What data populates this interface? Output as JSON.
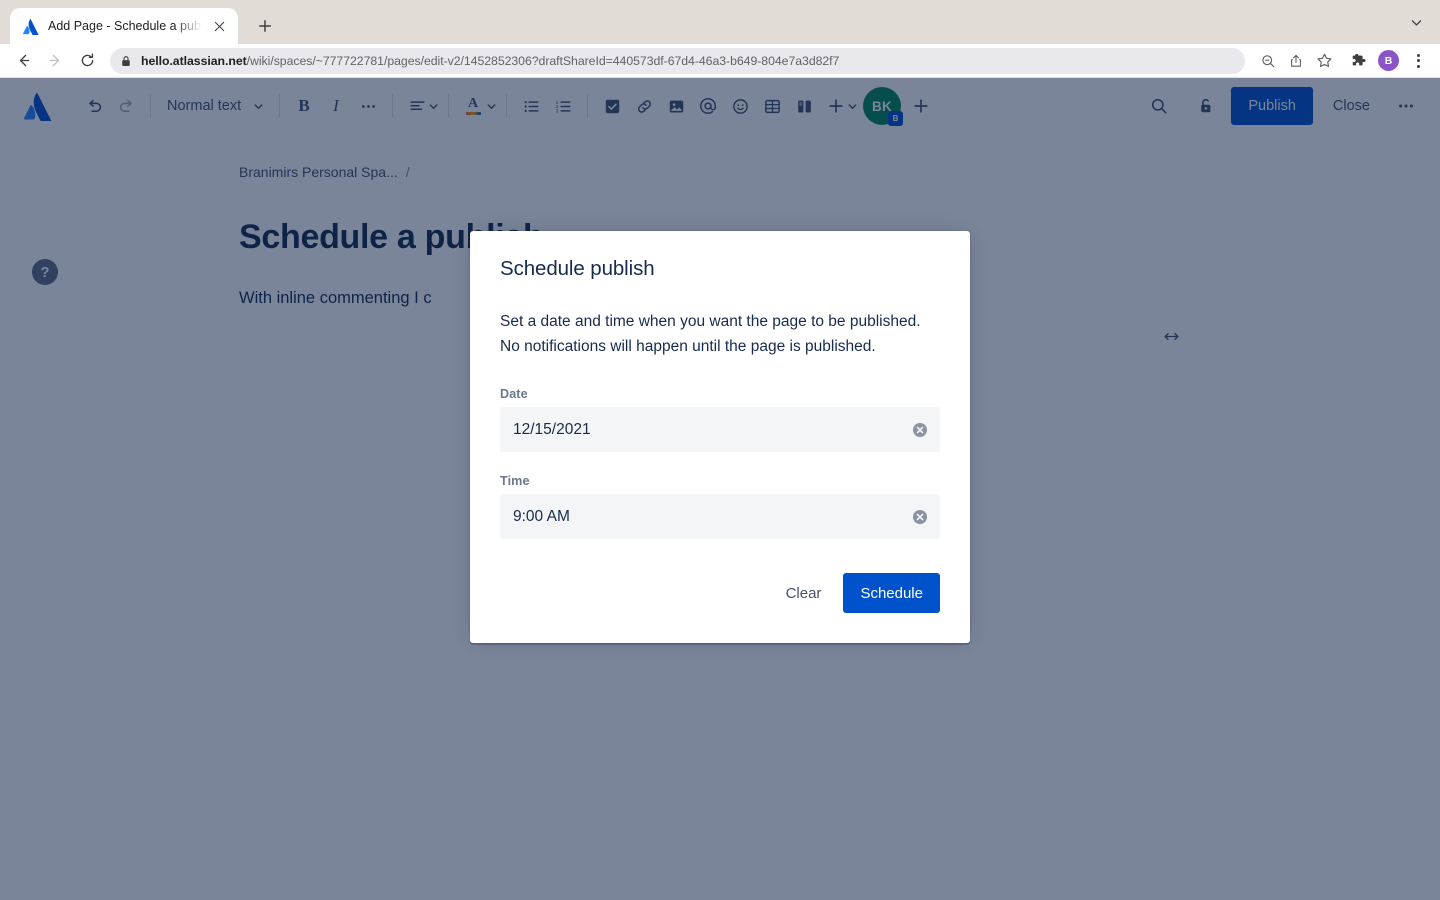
{
  "browser": {
    "tab": {
      "title": "Add Page - Schedule a publish",
      "favicon_icon": "atlassian-favicon",
      "close_icon": "close-icon"
    },
    "new_tab_icon": "plus-icon",
    "tab_list_icon": "chevron-down-icon",
    "nav": {
      "back_icon": "arrow-left-icon",
      "forward_icon": "arrow-right-icon",
      "reload_icon": "reload-icon"
    },
    "url": {
      "lock_icon": "lock-icon",
      "domain": "hello.atlassian.net",
      "path": "/wiki/spaces/~777722781/pages/edit-v2/1452852306?draftShareId=440573df-67d4-46a3-b649-804e7a3d82f7"
    },
    "actions": {
      "zoom_icon": "zoom-search-icon",
      "share_icon": "share-upload-icon",
      "bookmark_icon": "star-icon",
      "extensions_icon": "puzzle-piece-icon",
      "profile_initial": "B",
      "menu_icon": "kebab-menu-icon"
    }
  },
  "editor": {
    "logo_icon": "atlassian-logo",
    "undo_icon": "undo-icon",
    "redo_icon": "redo-icon",
    "text_style": "Normal text",
    "text_style_chevron": "chevron-down-icon",
    "bold_label": "B",
    "italic_label": "I",
    "more_formatting_icon": "ellipsis-icon",
    "align_icon": "text-align-icon",
    "align_chevron": "chevron-down-icon",
    "text_color_label": "A",
    "text_color_chevron": "chevron-down-icon",
    "bullet_list_icon": "bullet-list-icon",
    "numbered_list_icon": "numbered-list-icon",
    "task_icon": "task-checkbox-icon",
    "link_icon": "link-icon",
    "image_icon": "image-icon",
    "mention_icon": "mention-at-icon",
    "emoji_icon": "emoji-smiley-icon",
    "table_icon": "table-icon",
    "layout_icon": "page-layout-icon",
    "insert_icon": "plus-icon",
    "insert_chevron": "chevron-down-icon",
    "avatar_initials": "BK",
    "avatar_badge": "B",
    "add_collaborator_icon": "plus-icon",
    "search_icon": "search-icon",
    "restrictions_icon": "unlock-padlock-icon",
    "publish_label": "Publish",
    "close_label": "Close",
    "more_icon": "ellipsis-icon"
  },
  "page": {
    "breadcrumb_space": "Branimirs Personal Spa...",
    "breadcrumb_separator": "/",
    "width_toggle_icon": "horizontal-resize-icon",
    "title": "Schedule a publish",
    "paragraph": "With inline commenting I c",
    "help_label": "?"
  },
  "modal": {
    "title": "Schedule publish",
    "description": "Set a date and time when you want the page to be published. No notifications will happen until the page is published.",
    "date_label": "Date",
    "date_value": "12/15/2021",
    "date_placeholder": "Date",
    "date_clear_icon": "clear-circle-x-icon",
    "time_label": "Time",
    "time_value": "9:00 AM",
    "time_placeholder": "Time",
    "time_clear_icon": "clear-circle-x-icon",
    "clear_label": "Clear",
    "schedule_label": "Schedule"
  },
  "colors": {
    "brand_blue": "#0052cc",
    "avatar_green": "#00875a",
    "overlay": "#091e42",
    "text_dark": "#172b4d",
    "text_subtle": "#6b778c",
    "input_bg": "#f4f5f7",
    "chrome_tabstrip": "#e2dcd6"
  }
}
